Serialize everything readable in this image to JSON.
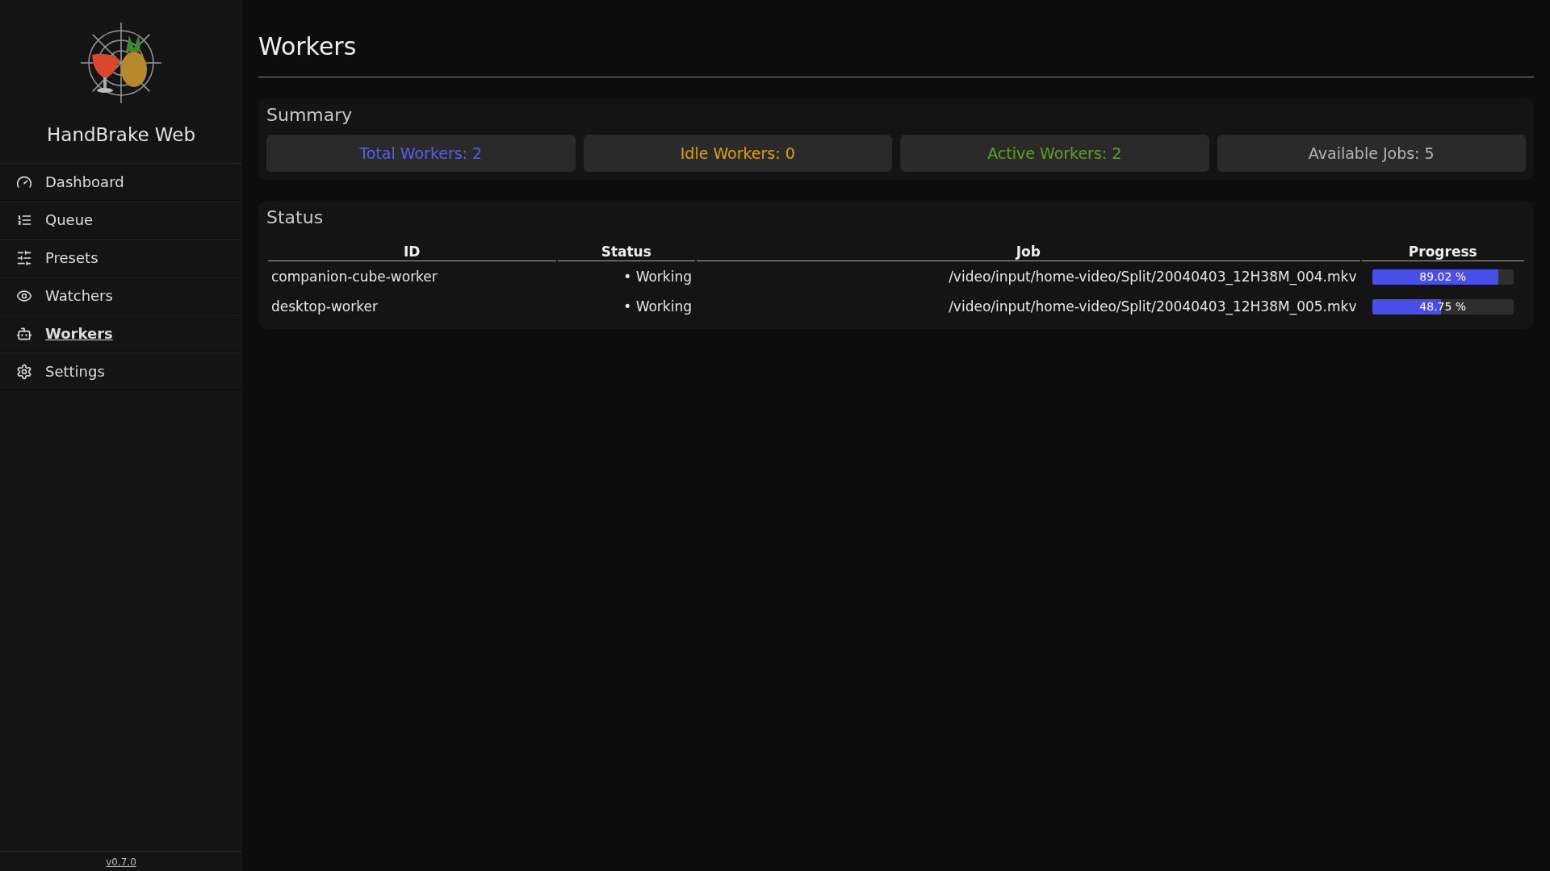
{
  "sidebar": {
    "app_name": "HandBrake Web",
    "items": [
      {
        "label": "Dashboard",
        "selected": false
      },
      {
        "label": "Queue",
        "selected": false
      },
      {
        "label": "Presets",
        "selected": false
      },
      {
        "label": "Watchers",
        "selected": false
      },
      {
        "label": "Workers",
        "selected": true
      },
      {
        "label": "Settings",
        "selected": false
      }
    ],
    "version": "v0.7.0"
  },
  "page_title": "Workers",
  "summary": {
    "title": "Summary",
    "stats": [
      {
        "label": "Total Workers: 2",
        "color": "#5b5bf0"
      },
      {
        "label": "Idle Workers: 0",
        "color": "#e0a000"
      },
      {
        "label": "Active Workers: 2",
        "color": "#5fa01e"
      },
      {
        "label": "Available Jobs: 5",
        "color": "#b4b4b4"
      }
    ]
  },
  "status": {
    "title": "Status",
    "columns": [
      "ID",
      "Status",
      "Job",
      "Progress"
    ],
    "rows": [
      {
        "id": "companion-cube-worker",
        "status": "• Working",
        "job": "/video/input/home-video/Split/20040403_12H38M_004.mkv",
        "level": 0.8902,
        "reading": "89.02 %"
      },
      {
        "id": "desktop-worker",
        "status": "• Working",
        "job": "/video/input/home-video/Split/20040403_12H38M_005.mkv",
        "level": 0.4875,
        "reading": "48.75 %"
      }
    ]
  }
}
